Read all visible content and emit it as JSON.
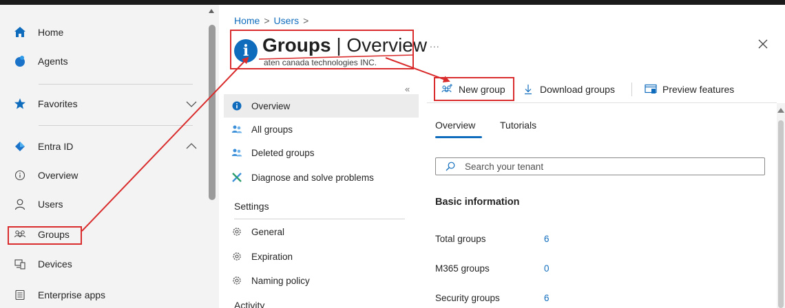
{
  "leftnav": {
    "items": [
      {
        "label": "Home",
        "icon": "home-icon"
      },
      {
        "label": "Agents",
        "icon": "agents-icon"
      },
      {
        "label": "Favorites",
        "icon": "star-icon"
      },
      {
        "label": "Entra ID",
        "icon": "entra-id-icon"
      },
      {
        "label": "Overview",
        "icon": "info-outline-icon"
      },
      {
        "label": "Users",
        "icon": "user-icon"
      },
      {
        "label": "Groups",
        "icon": "groups-icon"
      },
      {
        "label": "Devices",
        "icon": "devices-icon"
      },
      {
        "label": "Enterprise apps",
        "icon": "enterprise-apps-icon"
      }
    ]
  },
  "header": {
    "breadcrumb": [
      "Home",
      "Users"
    ],
    "breadcrumb_sep": ">",
    "title_main": "Groups",
    "title_sep": " | ",
    "title_sub": "Overview",
    "org": "aten canada technologies INC.",
    "more": "...",
    "collapse": "«"
  },
  "menu": {
    "items": [
      {
        "label": "Overview",
        "icon": "info-icon",
        "selected": true
      },
      {
        "label": "All groups",
        "icon": "groups-icon"
      },
      {
        "label": "Deleted groups",
        "icon": "groups-icon"
      },
      {
        "label": "Diagnose and solve problems",
        "icon": "wrench-icon"
      }
    ],
    "settings_header": "Settings",
    "settings_items": [
      {
        "label": "General",
        "icon": "gear-icon"
      },
      {
        "label": "Expiration",
        "icon": "gear-icon"
      },
      {
        "label": "Naming policy",
        "icon": "gear-icon"
      }
    ],
    "activity_header": "Activity"
  },
  "toolbar": {
    "new_group": "New group",
    "download_groups": "Download groups",
    "preview_features": "Preview features"
  },
  "tabs": [
    "Overview",
    "Tutorials"
  ],
  "search": {
    "placeholder": "Search your tenant"
  },
  "basic_info": {
    "title": "Basic information",
    "stats": [
      {
        "label": "Total groups",
        "value": "6"
      },
      {
        "label": "M365 groups",
        "value": "0"
      },
      {
        "label": "Security groups",
        "value": "6"
      }
    ]
  },
  "colors": {
    "accent": "#0f6cbd",
    "annotation": "#d92b2b"
  }
}
